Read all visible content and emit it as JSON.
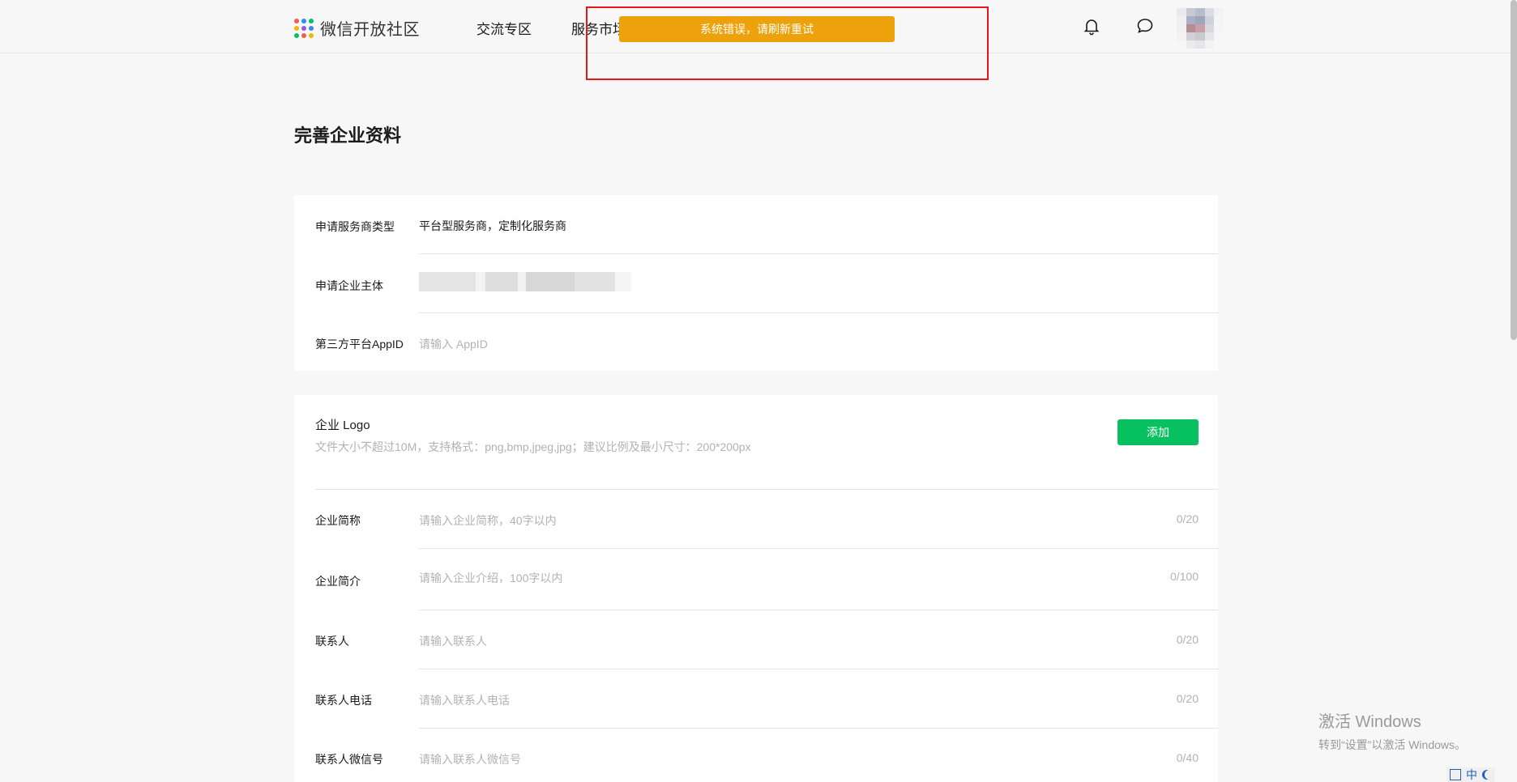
{
  "header": {
    "logo_text": "微信开放社区",
    "nav": [
      "交流专区",
      "服务市场"
    ],
    "toast": "系统错误，请刷新重试",
    "icons": [
      "bell-icon",
      "chat-icon"
    ]
  },
  "page": {
    "title": "完善企业资料"
  },
  "basic_info": {
    "service_type": {
      "label": "申请服务商类型",
      "value": "平台型服务商，定制化服务商"
    },
    "enterprise": {
      "label": "申请企业主体",
      "value": ""
    },
    "appid": {
      "label": "第三方平台AppID",
      "placeholder": "请输入 AppID"
    }
  },
  "enterprise_info": {
    "logo_title": "企业 Logo",
    "logo_hint": "文件大小不超过10M，支持格式：png,bmp,jpeg,jpg；建议比例及最小尺寸：200*200px",
    "add_button": "添加",
    "fields": [
      {
        "label": "企业简称",
        "placeholder": "请输入企业简称，40字以内",
        "counter": "0/20"
      },
      {
        "label": "企业简介",
        "placeholder": "请输入企业介绍，100字以内",
        "counter": "0/100"
      },
      {
        "label": "联系人",
        "placeholder": "请输入联系人",
        "counter": "0/20"
      },
      {
        "label": "联系人电话",
        "placeholder": "请输入联系人电话",
        "counter": "0/20"
      },
      {
        "label": "联系人微信号",
        "placeholder": "请输入联系人微信号",
        "counter": "0/40"
      }
    ]
  },
  "watermark": {
    "line1": "激活 Windows",
    "line2": "转到“设置”以激活 Windows。"
  },
  "tray": {
    "ime": "中"
  },
  "colors": {
    "toast_bg": "#eda20c",
    "highlight_border": "#e8161b",
    "primary_button": "#07c160"
  }
}
